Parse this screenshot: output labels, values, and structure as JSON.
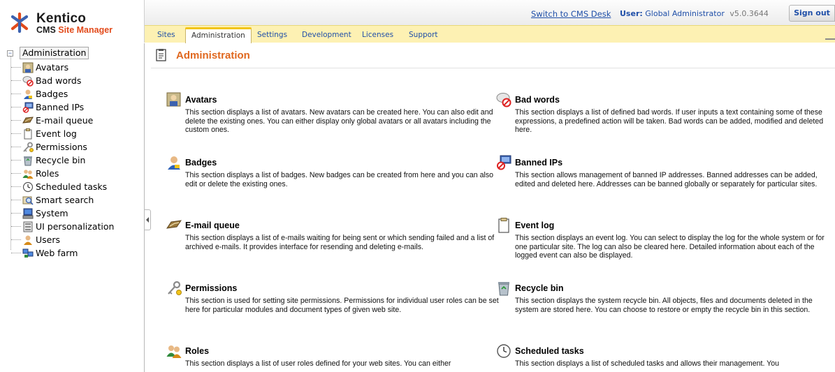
{
  "brand": {
    "name": "Kentico",
    "product_prefix": "CMS ",
    "product_accent": "Site Manager",
    "accent_color": "#e24a1a"
  },
  "topbar": {
    "switch_link": "Switch to CMS Desk",
    "user_label": "User:",
    "user_name": "Global Administrator",
    "version": "v5.0.3644",
    "signout": "Sign out"
  },
  "tabs": [
    {
      "label": "Sites"
    },
    {
      "label": "Administration",
      "active": true
    },
    {
      "label": "Settings"
    },
    {
      "label": "Development"
    },
    {
      "label": "Licenses"
    },
    {
      "label": "Support"
    }
  ],
  "tree": {
    "root": "Administration",
    "items": [
      {
        "label": "Avatars",
        "icon": "avatar-icon"
      },
      {
        "label": "Bad words",
        "icon": "bad-words-icon"
      },
      {
        "label": "Badges",
        "icon": "badges-icon"
      },
      {
        "label": "Banned IPs",
        "icon": "banned-ips-icon"
      },
      {
        "label": "E-mail queue",
        "icon": "email-queue-icon"
      },
      {
        "label": "Event log",
        "icon": "event-log-icon"
      },
      {
        "label": "Permissions",
        "icon": "permissions-icon"
      },
      {
        "label": "Recycle bin",
        "icon": "recycle-bin-icon"
      },
      {
        "label": "Roles",
        "icon": "roles-icon"
      },
      {
        "label": "Scheduled tasks",
        "icon": "clock-icon"
      },
      {
        "label": "Smart search",
        "icon": "smart-search-icon"
      },
      {
        "label": "System",
        "icon": "system-icon"
      },
      {
        "label": "UI personalization",
        "icon": "ui-personalization-icon"
      },
      {
        "label": "Users",
        "icon": "users-icon"
      },
      {
        "label": "Web farm",
        "icon": "web-farm-icon"
      }
    ]
  },
  "main": {
    "title": "Administration",
    "title_color": "#e0681f",
    "sections": [
      {
        "title": "Avatars",
        "desc": "This section displays a list of avatars. New avatars can be created here. You can also edit and delete the existing ones. You can either display only global avatars or all avatars including the custom ones."
      },
      {
        "title": "Bad words",
        "desc": "This section displays a list of defined bad words. If user inputs a text containing some of these expressions, a predefined action will be taken. Bad words can be added, modified and deleted here."
      },
      {
        "title": "Badges",
        "desc": "This section displays a list of badges. New badges can be created from here and you can also edit or delete the existing ones."
      },
      {
        "title": "Banned IPs",
        "desc": "This section allows management of banned IP addresses. Banned addresses can be added, edited and deleted here. Addresses can be banned globally or separately for particular sites."
      },
      {
        "title": "E-mail queue",
        "desc": "This section displays a list of e-mails waiting for being sent or which sending failed and a list of archived e-mails. It provides interface for resending and deleting e-mails."
      },
      {
        "title": "Event log",
        "desc": "This section displays an event log. You can select to display the log for the whole system or for one particular site. The log can also be cleared here. Detailed information about each of the logged event can also be displayed."
      },
      {
        "title": "Permissions",
        "desc": "This section is used for setting site permissions. Permissions for individual user roles can be set here for particular modules and document types of given web site."
      },
      {
        "title": "Recycle bin",
        "desc": "This section displays the system recycle bin. All objects, files and documents deleted in the system are stored here. You can choose to restore or empty the recycle bin in this section."
      },
      {
        "title": "Roles",
        "desc": "This section displays a list of user roles defined for your web sites. You can either"
      },
      {
        "title": "Scheduled tasks",
        "desc": "This section displays a list of scheduled tasks and allows their management. You"
      }
    ]
  }
}
